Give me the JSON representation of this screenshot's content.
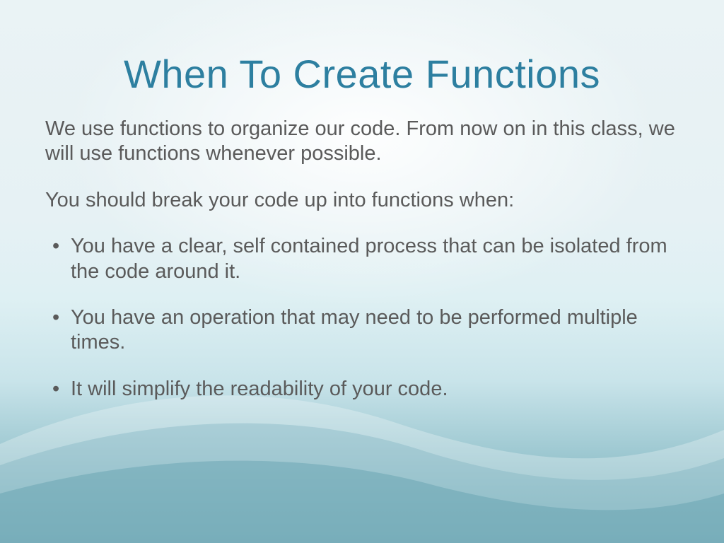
{
  "slide": {
    "title": "When To Create Functions",
    "intro": "We use functions to organize our code.  From now on in this class, we will use functions whenever possible.",
    "lead": "You should break your code up into functions when:",
    "bullets": [
      "You have a clear, self contained process that can be isolated from the code around it.",
      "You have an operation that may need to be performed multiple times.",
      "It will simplify the readability of your code."
    ]
  }
}
